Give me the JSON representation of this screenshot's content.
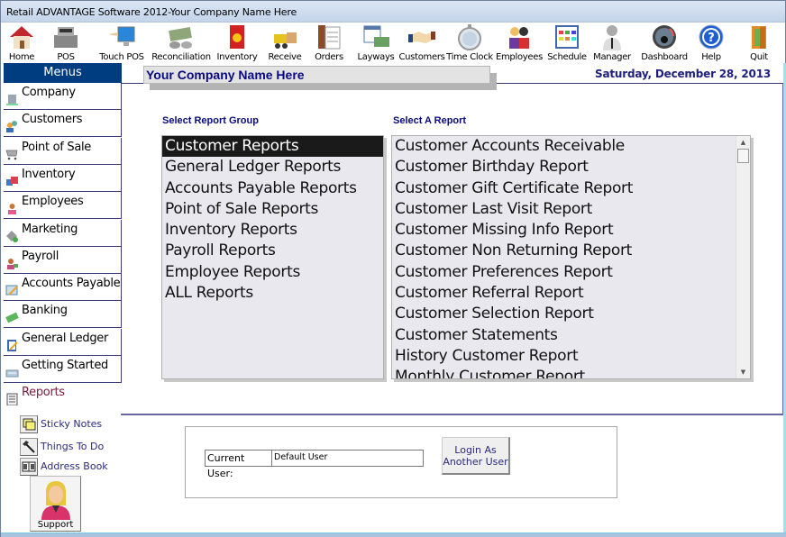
{
  "window": {
    "title": "Retail ADVANTAGE Software 2012-Your Company Name Here"
  },
  "toolbar": [
    {
      "label": "Home",
      "icon": "house-icon"
    },
    {
      "label": "POS",
      "icon": "cash-register-icon"
    },
    {
      "label": "Touch POS",
      "icon": "touch-monitor-icon"
    },
    {
      "label": "Reconciliation",
      "icon": "money-coins-icon"
    },
    {
      "label": "Inventory",
      "icon": "product-box-icon"
    },
    {
      "label": "Receive",
      "icon": "forklift-icon"
    },
    {
      "label": "Orders",
      "icon": "order-form-icon"
    },
    {
      "label": "Layways",
      "icon": "calendar-money-icon"
    },
    {
      "label": "Customers",
      "icon": "handshake-icon"
    },
    {
      "label": "Time Clock",
      "icon": "stopwatch-icon"
    },
    {
      "label": "Employees",
      "icon": "people-group-icon"
    },
    {
      "label": "Schedule",
      "icon": "schedule-grid-icon"
    },
    {
      "label": "Manager",
      "icon": "manager-icon"
    },
    {
      "label": "Dashboard",
      "icon": "gauge-icon"
    },
    {
      "label": "Help",
      "icon": "help-icon"
    },
    {
      "label": "Quit",
      "icon": "exit-door-icon"
    }
  ],
  "sidebar": {
    "header": "Menus",
    "items": [
      {
        "label": "Company",
        "icon": "building-icon"
      },
      {
        "label": "Customers",
        "icon": "customers-icon"
      },
      {
        "label": "Point of Sale",
        "icon": "cart-icon"
      },
      {
        "label": "Inventory",
        "icon": "inventory-boxes-icon"
      },
      {
        "label": "Employees",
        "icon": "employee-icon"
      },
      {
        "label": "Marketing",
        "icon": "marketing-tag-icon"
      },
      {
        "label": "Payroll",
        "icon": "payroll-icon"
      },
      {
        "label": "Accounts Payable",
        "icon": "invoice-pen-icon"
      },
      {
        "label": "Banking",
        "icon": "cash-bill-icon"
      },
      {
        "label": "General Ledger",
        "icon": "ledger-pen-icon"
      },
      {
        "label": "Getting Started",
        "icon": "keyboard-icon"
      },
      {
        "label": "Reports",
        "icon": "report-book-icon",
        "active": true
      }
    ]
  },
  "quick_links": [
    {
      "label": "Sticky Notes",
      "icon": "sticky-note-icon"
    },
    {
      "label": "Things To Do",
      "icon": "hammer-icon"
    },
    {
      "label": "Address Book",
      "icon": "address-book-icon"
    }
  ],
  "support": {
    "label": "Support",
    "icon": "support-agent-icon"
  },
  "header": {
    "company_name": "Your Company Name Here",
    "date": "Saturday, December 28, 2013"
  },
  "report_groups": {
    "label": "Select Report Group",
    "selected": "Customer Reports",
    "items": [
      "Customer Reports",
      "General Ledger Reports",
      "Accounts Payable Reports",
      "Point of Sale Reports",
      "Inventory Reports",
      "Payroll Reports",
      "Employee Reports",
      "ALL Reports"
    ]
  },
  "reports": {
    "label": "Select A Report",
    "items": [
      "Customer Accounts Receivable",
      "Customer Birthday Report",
      "Customer Gift Certificate Report",
      "Customer Last Visit Report",
      "Customer Missing Info Report",
      "Customer Non Returning Report",
      "Customer Preferences Report",
      "Customer Referral Report",
      "Customer Selection Report",
      "Customer Statements",
      "History Customer Report",
      "Monthly Customer Report"
    ],
    "scroll_up": "▲",
    "scroll_down": "▼"
  },
  "user": {
    "label": "Current User:",
    "value": "Default User",
    "login_button": "Login As Another User"
  }
}
